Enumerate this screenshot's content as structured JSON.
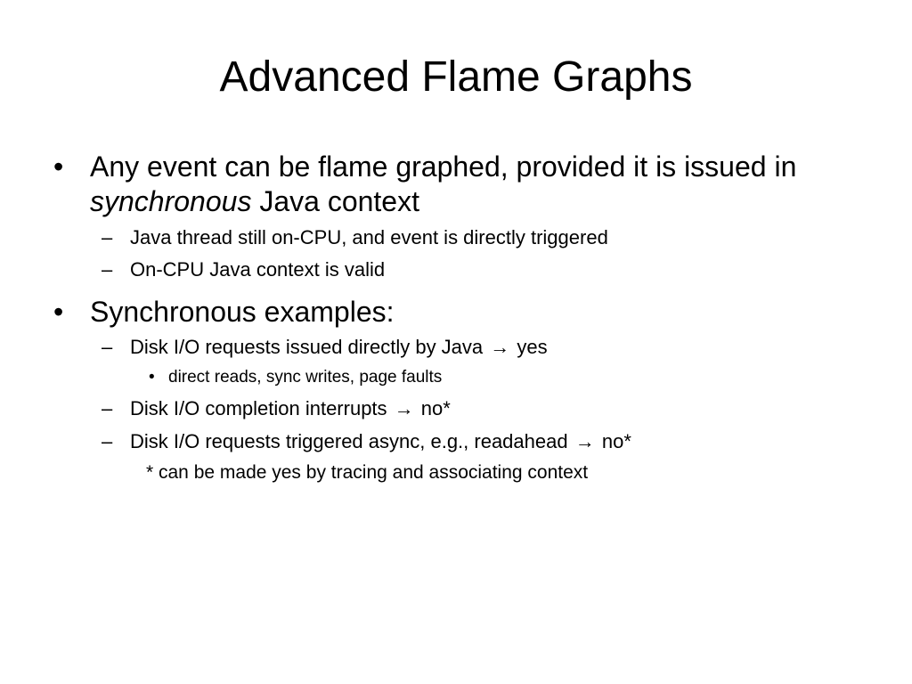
{
  "title": "Advanced Flame Graphs",
  "bullets": {
    "b1": {
      "glyph": "•",
      "line1": "Any event can be flame graphed, provided it is issued in",
      "line2_italic": "synchronous",
      "line2_rest": " Java context",
      "subs": [
        {
          "glyph": "–",
          "text": "Java thread still on-CPU, and event is directly triggered"
        },
        {
          "glyph": "–",
          "text": "On-CPU Java context is valid"
        }
      ]
    },
    "b2": {
      "glyph": "•",
      "text": "Synchronous examples:",
      "sub1": {
        "glyph": "–",
        "text": "Disk I/O requests issued directly by Java",
        "arrow": "→",
        "result": "yes"
      },
      "sub1_child": {
        "glyph": "•",
        "text": "direct reads, sync writes, page faults"
      },
      "sub2": {
        "glyph": "–",
        "text": "Disk I/O completion interrupts",
        "arrow": "→",
        "result": "no*"
      },
      "sub3": {
        "glyph": "–",
        "text": "Disk I/O requests triggered async, e.g., readahead",
        "arrow": "→",
        "result": "no*"
      },
      "footnote": "* can be made yes by tracing and associating context"
    }
  }
}
